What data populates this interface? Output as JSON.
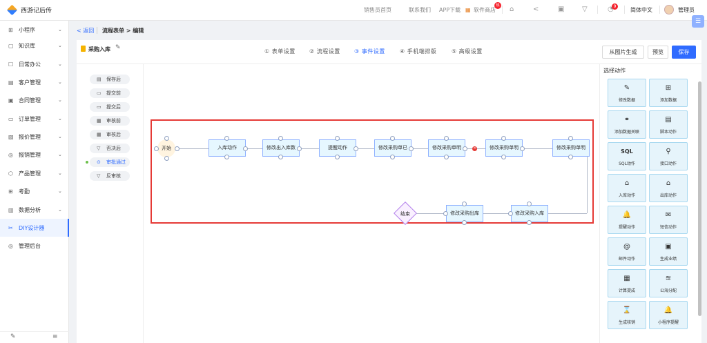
{
  "topbar": {
    "brand": "西游记后传",
    "nav": [
      "销售员首页",
      "联系我们",
      "APP下载",
      "软件商店"
    ],
    "hot_badge": "热",
    "msg_badge": "9",
    "lang": "简体中文",
    "user": "管理员"
  },
  "sidebar": {
    "items": [
      {
        "icon": "⊞",
        "label": "小程序"
      },
      {
        "icon": "▢",
        "label": "知识库"
      },
      {
        "icon": "☐",
        "label": "日常办公"
      },
      {
        "icon": "▤",
        "label": "客户管理"
      },
      {
        "icon": "▣",
        "label": "合同管理"
      },
      {
        "icon": "▭",
        "label": "订单管理"
      },
      {
        "icon": "▧",
        "label": "报价管理"
      },
      {
        "icon": "◎",
        "label": "报销管理"
      },
      {
        "icon": "⬡",
        "label": "产品管理"
      },
      {
        "icon": "⊞",
        "label": "考勤"
      },
      {
        "icon": "▥",
        "label": "数据分析"
      },
      {
        "icon": "✂",
        "label": "DIY设计器"
      },
      {
        "icon": "◎",
        "label": "管理后台"
      }
    ]
  },
  "breadcrumb": {
    "back": "< 返回",
    "title": "流程表单 > 编辑"
  },
  "form": {
    "name": "采购入库"
  },
  "steps": [
    "① 表单设置",
    "② 流程设置",
    "③ 事件设置",
    "④ 手机端排版",
    "⑤ 高级设置"
  ],
  "buttons": {
    "from_image": "从图片生成",
    "preview": "预览",
    "save": "保存"
  },
  "events": [
    {
      "icon": "▤",
      "label": "保存后"
    },
    {
      "icon": "▭",
      "label": "提交前"
    },
    {
      "icon": "▭",
      "label": "提交后"
    },
    {
      "icon": "▦",
      "label": "审核前"
    },
    {
      "icon": "▦",
      "label": "审核后"
    },
    {
      "icon": "▽",
      "label": "否决后"
    },
    {
      "icon": "⊙",
      "label": "审批通过"
    },
    {
      "icon": "▽",
      "label": "反审核"
    }
  ],
  "flow": {
    "start": "开始",
    "row1": [
      "入库动作",
      "修改出入库数",
      "提醒动作",
      "修改采购单已",
      "修改采购单明",
      "修改采购单明",
      "修改采购单明"
    ],
    "row2": [
      "修改采购入库",
      "修改采购出库"
    ],
    "end": "结束"
  },
  "panel": {
    "title": "选择动作",
    "actions": [
      {
        "icon": "✎",
        "label": "修改数据"
      },
      {
        "icon": "⊞",
        "label": "添加数据"
      },
      {
        "icon": "⚭",
        "label": "添加数据关联"
      },
      {
        "icon": "▤",
        "label": "脚本动作"
      },
      {
        "icon": "SQL",
        "label": "SQL动作"
      },
      {
        "icon": "⚲",
        "label": "接口动作"
      },
      {
        "icon": "⌂",
        "label": "入库动作"
      },
      {
        "icon": "⌂",
        "label": "出库动作"
      },
      {
        "icon": "🔔",
        "label": "提醒动作"
      },
      {
        "icon": "✉",
        "label": "短信动作"
      },
      {
        "icon": "@",
        "label": "邮件动作"
      },
      {
        "icon": "▣",
        "label": "生成业绩"
      },
      {
        "icon": "▦",
        "label": "计算提成"
      },
      {
        "icon": "≋",
        "label": "公海分配"
      },
      {
        "icon": "⌛",
        "label": "生成核销"
      },
      {
        "icon": "🔔",
        "label": "小程序提醒"
      }
    ]
  },
  "colors": {
    "accent": "#2f6bff",
    "highlight": "#e53935"
  }
}
